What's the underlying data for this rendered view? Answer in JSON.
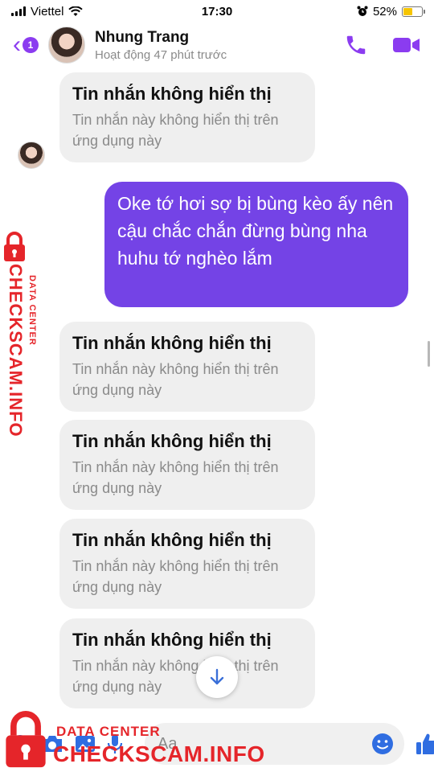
{
  "status_bar": {
    "carrier": "Viettel",
    "time": "17:30",
    "battery": "52%",
    "battery_level": 0.52
  },
  "header": {
    "badge": "1",
    "name": "Nhung Trang",
    "status": "Hoạt động 47 phút trước"
  },
  "messages": [
    {
      "type": "incoming",
      "title": "Tin nhắn không hiển thị",
      "body": "Tin nhắn này không hiển thị trên ứng dụng này"
    },
    {
      "type": "outgoing",
      "text": "Oke tớ hơi sợ bị bùng kèo ấy nên cậu chắc chắn đừng bùng nha huhu tớ nghèo lắm"
    },
    {
      "type": "incoming",
      "title": "Tin nhắn không hiển thị",
      "body": "Tin nhắn này không hiển thị trên ứng dụng này"
    },
    {
      "type": "incoming",
      "title": "Tin nhắn không hiển thị",
      "body": "Tin nhắn này không hiển thị trên ứng dụng này"
    },
    {
      "type": "incoming",
      "title": "Tin nhắn không hiển thị",
      "body": "Tin nhắn này không hiển thị trên ứng dụng này"
    },
    {
      "type": "incoming",
      "title": "Tin nhắn không hiển thị",
      "body": "Tin nhắn này không hiển thị trên ứng dụng này"
    }
  ],
  "composer": {
    "placeholder": "Aa"
  },
  "watermark": {
    "label": "DATA CENTER",
    "brand": "CHECKSCAM.INFO"
  },
  "colors": {
    "accent": "#8b3cf0",
    "outgoing_bubble": "#7443e6",
    "incoming_bubble": "#efefef",
    "watermark": "#e5252a"
  }
}
